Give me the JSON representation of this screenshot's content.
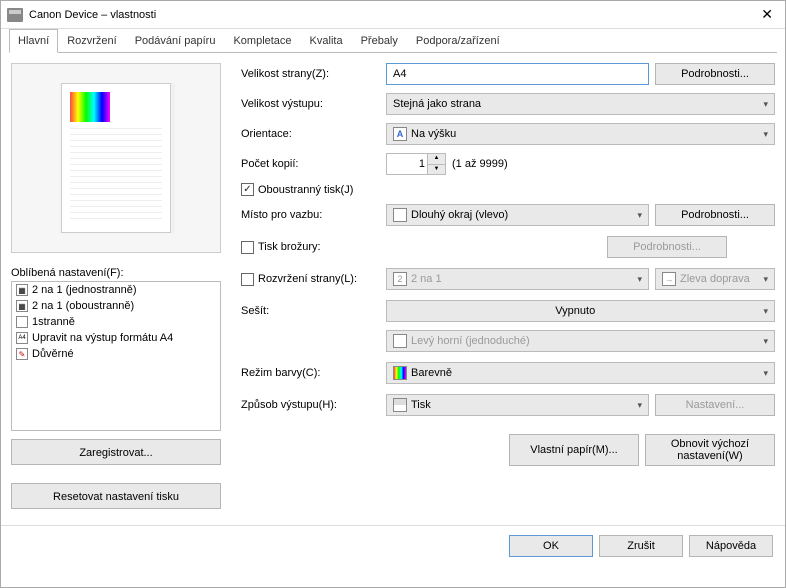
{
  "title": "Canon Device – vlastnosti",
  "tabs": [
    "Hlavní",
    "Rozvržení",
    "Podávání papíru",
    "Kompletace",
    "Kvalita",
    "Přebaly",
    "Podpora/zařízení"
  ],
  "left": {
    "fav_label": "Oblíbená nastavení(F):",
    "fav_items": [
      {
        "icon": "▦",
        "text": "2 na 1 (jednostranně)"
      },
      {
        "icon": "▦",
        "text": "2 na 1 (oboustranně)"
      },
      {
        "icon": "",
        "text": "1stranně"
      },
      {
        "icon": "A4",
        "text": "Upravit na výstup formátu A4"
      },
      {
        "icon": "✎",
        "text": "Důvěrné"
      }
    ],
    "register_btn": "Zaregistrovat...",
    "reset_btn": "Resetovat nastavení tisku"
  },
  "labels": {
    "page_size": "Velikost strany(Z):",
    "output_size": "Velikost výstupu:",
    "orientation": "Orientace:",
    "copies": "Počet kopií:",
    "duplex": "Oboustranný tisk(J)",
    "binding": "Místo pro vazbu:",
    "booklet": "Tisk brožury:",
    "layout": "Rozvržení strany(L):",
    "staple": "Sešít:",
    "color": "Režim barvy(C):",
    "output": "Způsob výstupu(H):"
  },
  "values": {
    "page_size": "A4",
    "output_size": "Stejná jako strana",
    "orientation": "Na výšku",
    "copies": "1",
    "copies_range": "(1 až 9999)",
    "binding": "Dlouhý okraj (vlevo)",
    "layout": "2 na 1",
    "layout_order": "Zleva doprava",
    "staple": "Vypnuto",
    "staple_pos": "Levý horní (jednoduché)",
    "color": "Barevně",
    "output": "Tisk"
  },
  "buttons": {
    "details": "Podrobnosti...",
    "details_disabled": "Podrobnosti...",
    "settings": "Nastavení...",
    "custom_paper": "Vlastní papír(M)...",
    "restore_defaults": "Obnovit výchozí nastavení(W)",
    "ok": "OK",
    "cancel": "Zrušit",
    "help": "Nápověda"
  }
}
